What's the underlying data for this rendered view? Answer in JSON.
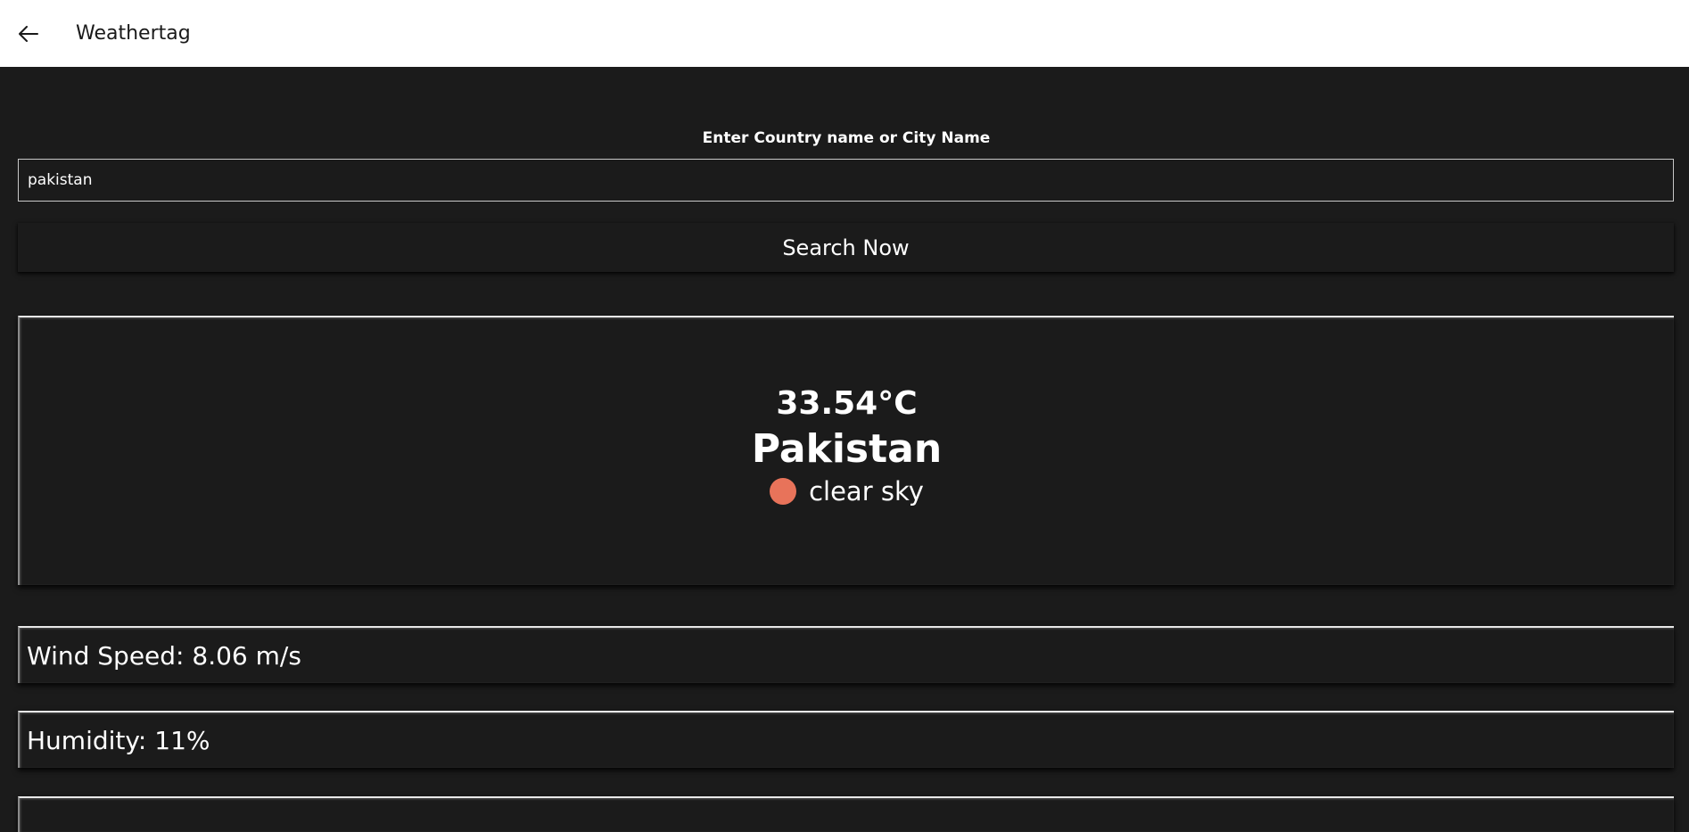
{
  "app": {
    "title": "Weathertag",
    "back_icon": "arrow-left-icon"
  },
  "search": {
    "label": "Enter Country name or City Name",
    "value": "pakistan",
    "button_label": "Search Now"
  },
  "weather": {
    "temperature": "33.54°C",
    "location": "Pakistan",
    "condition_icon": "sun-icon",
    "condition_icon_color": "#e8735a",
    "condition": "clear sky"
  },
  "stats": {
    "wind": "Wind Speed: 8.06 m/s",
    "humidity": "Humidity: 11%"
  },
  "colors": {
    "background": "#1b1b1b",
    "titlebar": "#ffffff",
    "text": "#ffffff"
  }
}
